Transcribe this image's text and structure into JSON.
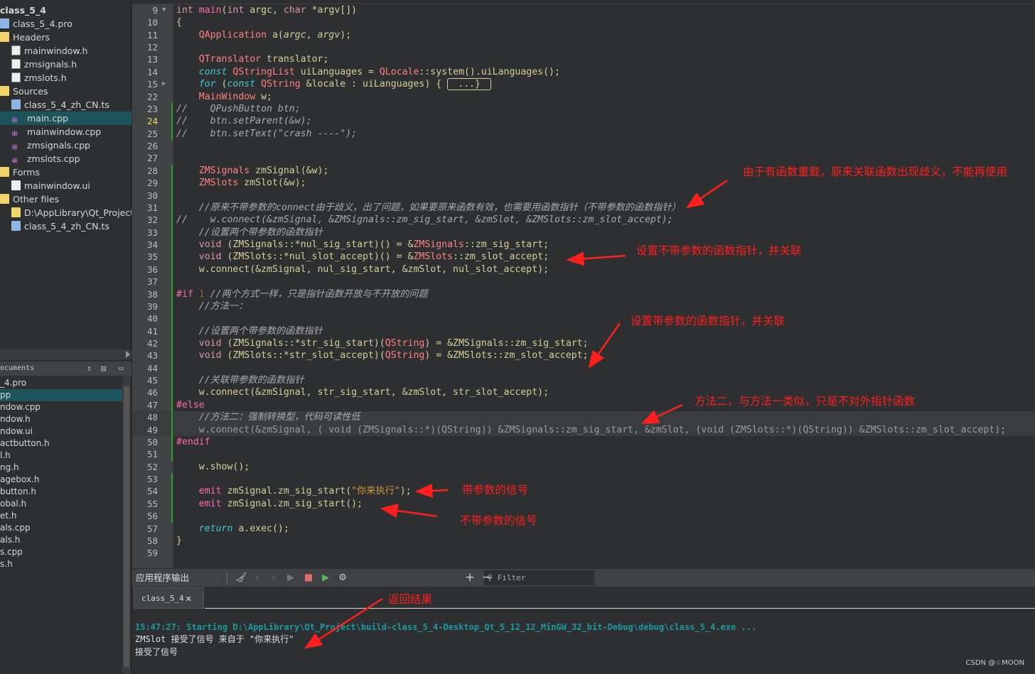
{
  "project_tree": {
    "root": "class_5_4",
    "items": [
      {
        "label": "class_5_4.pro",
        "icon": "qt-pro-icon",
        "indent": 0
      },
      {
        "label": "Headers",
        "icon": "folder-icon",
        "indent": 0
      },
      {
        "label": "mainwindow.h",
        "icon": "header-file-icon",
        "indent": 1
      },
      {
        "label": "zmsignals.h",
        "icon": "header-file-icon",
        "indent": 1
      },
      {
        "label": "zmslots.h",
        "icon": "header-file-icon",
        "indent": 1
      },
      {
        "label": "Sources",
        "icon": "folder-icon",
        "indent": 0
      },
      {
        "label": "class_5_4_zh_CN.ts",
        "icon": "ts-file-icon",
        "indent": 1
      },
      {
        "label": "main.cpp",
        "icon": "cpp-file-icon",
        "indent": 1,
        "selected": true
      },
      {
        "label": "mainwindow.cpp",
        "icon": "cpp-file-icon",
        "indent": 1
      },
      {
        "label": "zmsignals.cpp",
        "icon": "cpp-file-icon",
        "indent": 1
      },
      {
        "label": "zmslots.cpp",
        "icon": "cpp-file-icon",
        "indent": 1
      },
      {
        "label": "Forms",
        "icon": "folder-icon",
        "indent": 0
      },
      {
        "label": "mainwindow.ui",
        "icon": "ui-file-icon",
        "indent": 1
      },
      {
        "label": "Other files",
        "icon": "folder-icon",
        "indent": 0
      },
      {
        "label": "D:\\AppLibrary\\Qt_Project\\",
        "icon": "folder-icon",
        "indent": 1
      },
      {
        "label": "class_5_4_zh_CN.ts",
        "icon": "ts-file-icon",
        "indent": 1
      }
    ]
  },
  "open_documents": {
    "title": "ocuments",
    "items": [
      "_4.pro",
      "pp",
      "ndow.cpp",
      "ndow.h",
      "ndow.ui",
      "actbutton.h",
      "l.h",
      "ng.h",
      "agebox.h",
      "button.h",
      "obal.h",
      "et.h",
      "als.cpp",
      "als.h",
      "s.cpp",
      "s.h"
    ],
    "selected_index": 1
  },
  "editor": {
    "current_line": "24",
    "lines": [
      {
        "n": "9",
        "fold": "open",
        "seg": [
          [
            "int ",
            "k"
          ],
          [
            "main",
            "p"
          ],
          [
            "(",
            "d"
          ],
          [
            "int ",
            "k"
          ],
          [
            "argc, ",
            "d"
          ],
          [
            "char ",
            "k"
          ],
          [
            "*argv[])",
            "d"
          ]
        ]
      },
      {
        "n": "10",
        "seg": [
          [
            "{",
            "d"
          ]
        ]
      },
      {
        "n": "11",
        "seg": [
          [
            "    ",
            "d"
          ],
          [
            "QApplication",
            "ty"
          ],
          [
            " a(",
            "d"
          ],
          [
            "argc",
            "pr"
          ],
          [
            ", ",
            "d"
          ],
          [
            "argv",
            "pr"
          ],
          [
            ");",
            "d"
          ]
        ]
      },
      {
        "n": "12",
        "seg": []
      },
      {
        "n": "13",
        "seg": [
          [
            "    ",
            "d"
          ],
          [
            "QTranslator",
            "ty"
          ],
          [
            " translator;",
            "d"
          ]
        ]
      },
      {
        "n": "14",
        "seg": [
          [
            "    ",
            "d"
          ],
          [
            "const ",
            "ik"
          ],
          [
            "QStringList",
            "ty"
          ],
          [
            " uiLanguages = ",
            "d"
          ],
          [
            "QLocale",
            "ty"
          ],
          [
            "::system().uiLanguages();",
            "d"
          ]
        ]
      },
      {
        "n": "15",
        "fold": "closed",
        "seg": [
          [
            "    ",
            "d"
          ],
          [
            "for ",
            "ik"
          ],
          [
            "(",
            "d"
          ],
          [
            "const ",
            "ik"
          ],
          [
            "QString",
            "ty"
          ],
          [
            " &locale : uiLanguages) { ",
            "d"
          ],
          [
            "...}",
            "fold"
          ]
        ]
      },
      {
        "n": "22",
        "seg": [
          [
            "    ",
            "d"
          ],
          [
            "MainWindow",
            "ty"
          ],
          [
            " w;",
            "d"
          ]
        ]
      },
      {
        "n": "23",
        "chg": true,
        "seg": [
          [
            "//    QPushButton btn;",
            "c"
          ]
        ]
      },
      {
        "n": "24",
        "chg": true,
        "seg": [
          [
            "//    btn.setParent(&w);",
            "c"
          ]
        ]
      },
      {
        "n": "25",
        "chg": true,
        "seg": [
          [
            "//    btn.setText(\"crash ----\");",
            "c"
          ]
        ]
      },
      {
        "n": "26",
        "seg": []
      },
      {
        "n": "27",
        "seg": []
      },
      {
        "n": "28",
        "chg": true,
        "seg": [
          [
            "    ",
            "d"
          ],
          [
            "ZMSignals",
            "ty"
          ],
          [
            " zmSignal(&w);",
            "d"
          ]
        ]
      },
      {
        "n": "29",
        "chg": true,
        "seg": [
          [
            "    ",
            "d"
          ],
          [
            "ZMSlots",
            "ty"
          ],
          [
            " zmSlot(&w);",
            "d"
          ]
        ]
      },
      {
        "n": "30",
        "chg": true,
        "seg": []
      },
      {
        "n": "31",
        "chg": true,
        "seg": [
          [
            "    //原来不带参数的connect由于歧义，出了问题，如果要原来函数有效，也需要用函数指针（不带参数的函数指针）",
            "c"
          ]
        ]
      },
      {
        "n": "32",
        "chg": true,
        "seg": [
          [
            "//    w.connect(&zmSignal, &ZMSignals::zm_sig_start, &zmSlot, &ZMSlots::zm_slot_accept);",
            "c"
          ]
        ]
      },
      {
        "n": "33",
        "chg": true,
        "seg": [
          [
            "    //设置两个带参数的函数指针",
            "c"
          ]
        ]
      },
      {
        "n": "34",
        "chg": true,
        "seg": [
          [
            "    ",
            "d"
          ],
          [
            "void ",
            "k"
          ],
          [
            "(ZMSignals::*nul_sig_start)() = &",
            "d"
          ],
          [
            "ZMSignals",
            "ty"
          ],
          [
            "::zm_sig_start;",
            "d"
          ]
        ]
      },
      {
        "n": "35",
        "chg": true,
        "seg": [
          [
            "    ",
            "d"
          ],
          [
            "void ",
            "k"
          ],
          [
            "(ZMSlots::*nul_slot_accept)() = &",
            "d"
          ],
          [
            "ZMSlots",
            "ty"
          ],
          [
            "::zm_slot_accept;",
            "d"
          ]
        ]
      },
      {
        "n": "36",
        "chg": true,
        "seg": [
          [
            "    w.connect(&zmSignal, nul_sig_start, &zmSlot, nul_slot_accept);",
            "d"
          ]
        ]
      },
      {
        "n": "37",
        "chg": true,
        "seg": []
      },
      {
        "n": "38",
        "chg": true,
        "seg": [
          [
            "#if ",
            "p"
          ],
          [
            "1 ",
            "n"
          ],
          [
            "//两个方式一样，只是指针函数开放与不开放的问题",
            "c"
          ]
        ]
      },
      {
        "n": "39",
        "chg": true,
        "seg": [
          [
            "    //方法一：",
            "c"
          ]
        ]
      },
      {
        "n": "40",
        "chg": true,
        "seg": []
      },
      {
        "n": "41",
        "chg": true,
        "seg": [
          [
            "    //设置两个带参数的函数指针",
            "c"
          ]
        ]
      },
      {
        "n": "42",
        "chg": true,
        "seg": [
          [
            "    ",
            "d"
          ],
          [
            "void ",
            "k"
          ],
          [
            "(ZMSignals::*str_sig_start)(",
            "d"
          ],
          [
            "QString",
            "ty"
          ],
          [
            ") = &ZMSignals::zm_sig_start;",
            "d"
          ]
        ]
      },
      {
        "n": "43",
        "chg": true,
        "seg": [
          [
            "    ",
            "d"
          ],
          [
            "void ",
            "k"
          ],
          [
            "(ZMSlots::*str_slot_accept)(",
            "d"
          ],
          [
            "QString",
            "ty"
          ],
          [
            ") = &ZMSlots::zm_slot_accept;",
            "d"
          ]
        ]
      },
      {
        "n": "44",
        "chg": true,
        "seg": []
      },
      {
        "n": "45",
        "chg": true,
        "seg": [
          [
            "    //关联带参数的函数指针",
            "c"
          ]
        ]
      },
      {
        "n": "46",
        "chg": true,
        "seg": [
          [
            "    w.connect(&zmSignal, str_sig_start, &zmSlot, str_slot_accept);",
            "d"
          ]
        ]
      },
      {
        "n": "47",
        "chg": true,
        "seg": [
          [
            "#else",
            "p"
          ]
        ]
      },
      {
        "n": "48",
        "chg": true,
        "inactive": true,
        "seg": [
          [
            "    //方法二：强制转换型，代码可读性低",
            "c"
          ]
        ]
      },
      {
        "n": "49",
        "chg": true,
        "inactive": true,
        "seg": [
          [
            "    w.connect(&zmSignal, ( void (ZMSignals::*)(QString)) &ZMSignals::zm_sig_start, &zmSlot, (void (ZMSlots::*)(QString)) &ZMSlots::zm_slot_accept);",
            "g"
          ]
        ]
      },
      {
        "n": "50",
        "chg": true,
        "seg": [
          [
            "#endif",
            "p"
          ]
        ]
      },
      {
        "n": "51",
        "chg": true,
        "seg": []
      },
      {
        "n": "52",
        "seg": [
          [
            "    w.show();",
            "d"
          ]
        ]
      },
      {
        "n": "53",
        "chg": true,
        "seg": []
      },
      {
        "n": "54",
        "chg": true,
        "seg": [
          [
            "    ",
            "d"
          ],
          [
            "emit ",
            "p"
          ],
          [
            "zmSignal.zm_sig_start(",
            "d"
          ],
          [
            "\"你来执行\"",
            "s"
          ],
          [
            ");",
            "d"
          ]
        ]
      },
      {
        "n": "55",
        "chg": true,
        "seg": [
          [
            "    ",
            "d"
          ],
          [
            "emit ",
            "p"
          ],
          [
            "zmSignal.zm_sig_start();",
            "d"
          ]
        ]
      },
      {
        "n": "56",
        "chg": true,
        "seg": []
      },
      {
        "n": "57",
        "seg": [
          [
            "    ",
            "d"
          ],
          [
            "return ",
            "ik"
          ],
          [
            "a.exec();",
            "d"
          ]
        ]
      },
      {
        "n": "58",
        "seg": [
          [
            "}",
            "d"
          ]
        ]
      },
      {
        "n": "59",
        "seg": []
      }
    ]
  },
  "annotations": [
    {
      "text": "由于有函数重载，原来关联函数出现歧义，不能再使用"
    },
    {
      "text": "设置不带参数的函数指针，并关联"
    },
    {
      "text": "设置带参数的函数指针，并关联"
    },
    {
      "text": "方法二，与方法一类似，只是不对外指针函数"
    },
    {
      "text": "带参数的信号"
    },
    {
      "text": "不带参数的信号"
    },
    {
      "text": "返回结果"
    }
  ],
  "output_pane": {
    "title": "应用程序输出",
    "filter_placeholder": "Filter",
    "tab_label": "class_5_4",
    "lines": [
      "15:47:27: Starting D:\\AppLibrary\\Qt_Project\\build-class_5_4-Desktop_Qt_5_12_12_MinGW_32_bit-Debug\\debug\\class_5_4.exe ...",
      "ZMSlot 接受了信号 来自于 \"你来执行\"",
      "接受了信号"
    ]
  },
  "watermark": "CSDN @☆MOON",
  "colors": {
    "annotation": "#ff1f1f",
    "selection": "#1d545c",
    "stop": "#e06c6c",
    "run_debug": "#5fb85f"
  }
}
